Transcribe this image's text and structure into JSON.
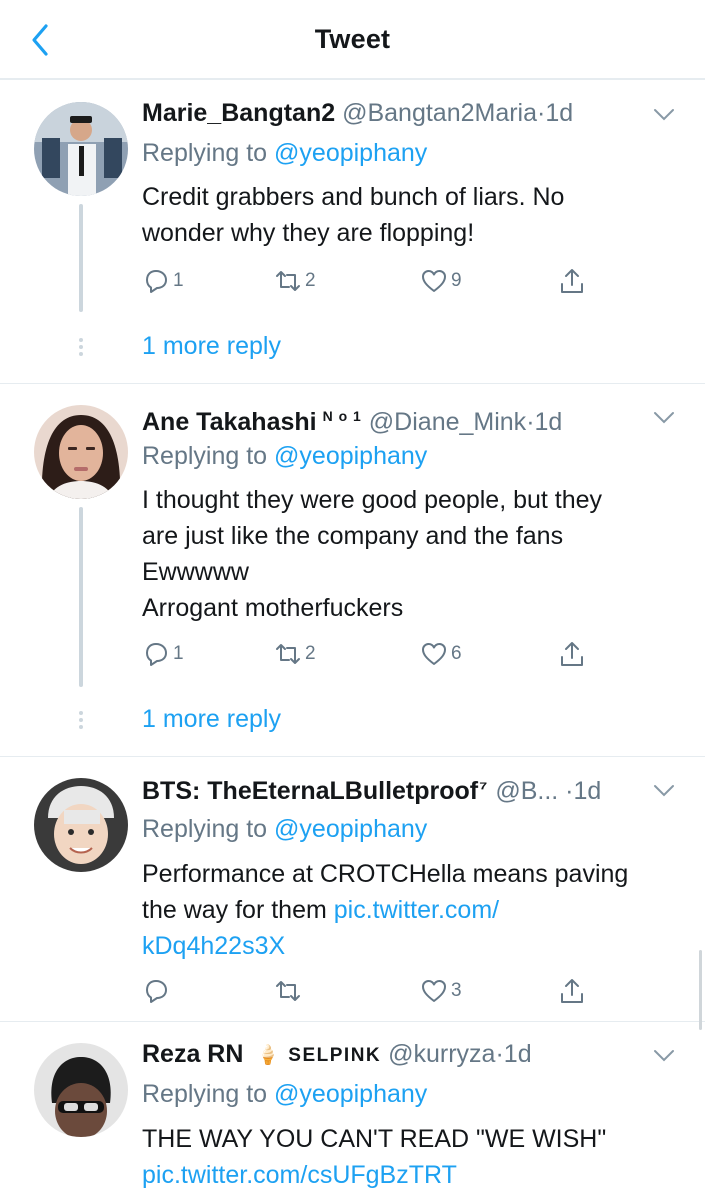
{
  "header": {
    "title": "Tweet"
  },
  "colors": {
    "accent": "#1da1f2",
    "muted": "#657786",
    "text": "#14171a",
    "divider": "#e6ecf0"
  },
  "tweets": [
    {
      "name": "Marie_Bangtan2",
      "badge": "",
      "handle": "@Bangtan2Maria",
      "separator": "·",
      "time": "1d",
      "replying_label": "Replying to",
      "replying_to": "@yeopiphany",
      "text_lines": [
        "Credit grabbers and bunch of liars. No",
        "wonder why they are flopping!"
      ],
      "link_lines": [],
      "replies": "1",
      "retweets": "2",
      "likes": "9",
      "more_replies": "1 more reply"
    },
    {
      "name": "Ane Takahashi",
      "badge": "N o 1",
      "handle": "@Diane_Mink",
      "separator": "·",
      "time": "1d",
      "replying_label": "Replying to",
      "replying_to": "@yeopiphany",
      "text_lines": [
        "I thought they were good people, but they",
        "are just like the company and the fans",
        "Ewwwww",
        "Arrogant motherfuckers"
      ],
      "link_lines": [],
      "replies": "1",
      "retweets": "2",
      "likes": "6",
      "more_replies": "1 more reply"
    },
    {
      "name": "BTS: TheEternaLBulletproof",
      "badge": "⁷",
      "handle": "@B...",
      "separator": "·",
      "time": "1d",
      "replying_label": "Replying to",
      "replying_to": "@yeopiphany",
      "text_lines": [
        "Performance at CROTCHella means paving",
        "the way for them"
      ],
      "link_lines": [
        "pic.twitter.com/",
        "kDq4h22s3X"
      ],
      "replies": "",
      "retweets": "",
      "likes": "3",
      "more_replies": ""
    },
    {
      "name": "Reza RN",
      "badge": "🍦 SELPINK",
      "handle": "@kurryza",
      "separator": "·",
      "time": "1d",
      "replying_label": "Replying to",
      "replying_to": "@yeopiphany",
      "text_lines": [
        "THE WAY YOU CAN'T READ \"WE WISH\""
      ],
      "link_lines": [
        "pic.twitter.com/csUFgBzTRT"
      ],
      "replies": "",
      "retweets": "",
      "likes": "",
      "more_replies": ""
    }
  ]
}
